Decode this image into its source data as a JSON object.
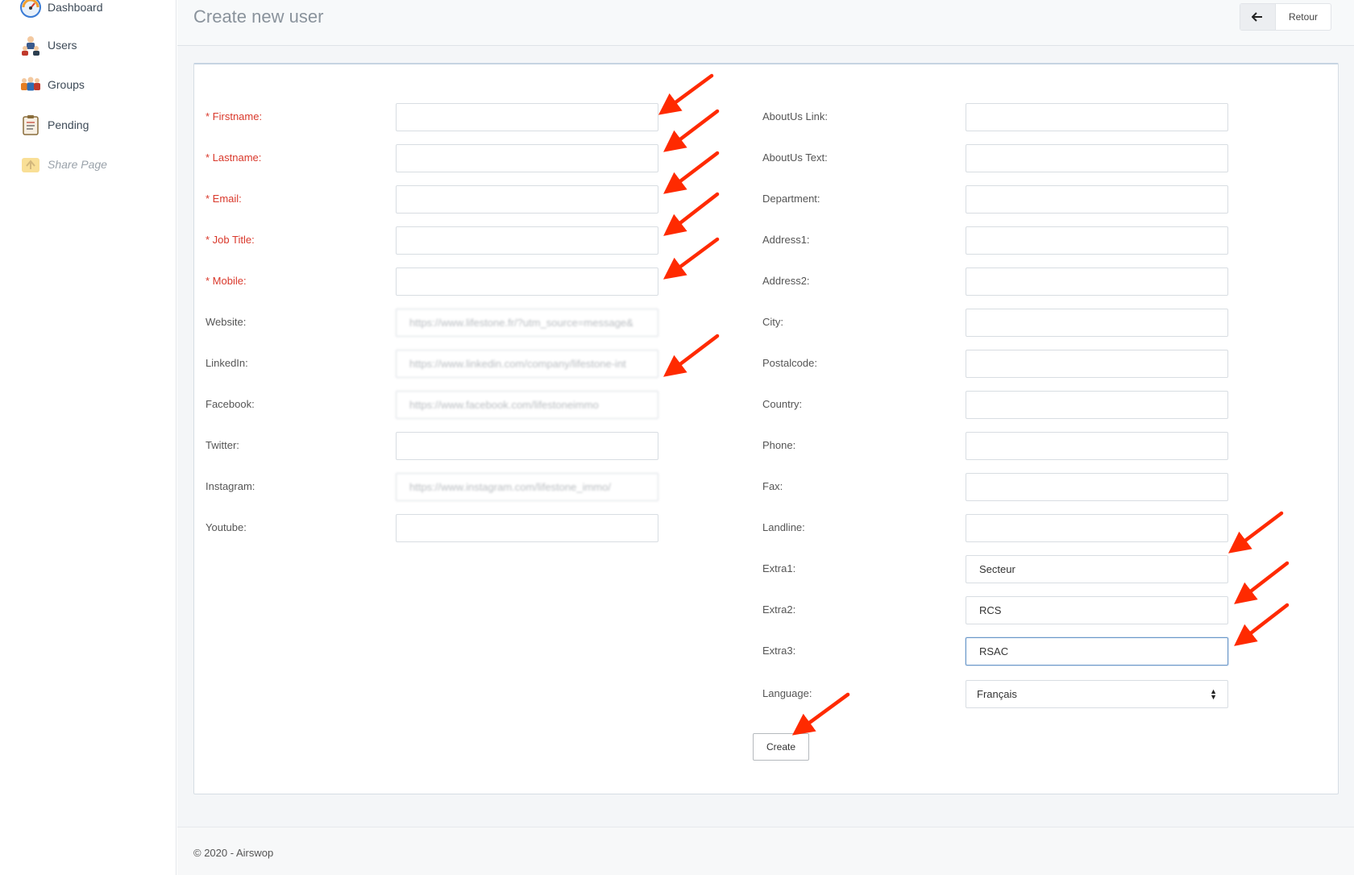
{
  "sidebar": {
    "items": [
      {
        "label": "Dashboard",
        "icon": "dashboard-icon"
      },
      {
        "label": "Users",
        "icon": "users-icon"
      },
      {
        "label": "Groups",
        "icon": "groups-icon"
      },
      {
        "label": "Pending",
        "icon": "clipboard-icon"
      },
      {
        "label": "Share Page",
        "icon": "share-icon",
        "disabled": true
      }
    ]
  },
  "header": {
    "title": "Create new user",
    "back_label": "Retour"
  },
  "form": {
    "left": [
      {
        "label": "* Firstname:",
        "value": "",
        "required": true
      },
      {
        "label": "* Lastname:",
        "value": "",
        "required": true
      },
      {
        "label": "* Email:",
        "value": "",
        "required": true
      },
      {
        "label": "* Job Title:",
        "value": "",
        "required": true
      },
      {
        "label": "* Mobile:",
        "value": "",
        "required": true
      },
      {
        "label": "Website:",
        "value": "https://www.lifestone.fr/?utm_source=message&",
        "blurred": true
      },
      {
        "label": "LinkedIn:",
        "value": "https://www.linkedin.com/company/lifestone-int",
        "blurred": true
      },
      {
        "label": "Facebook:",
        "value": "https://www.facebook.com/lifestoneimmo",
        "blurred": true
      },
      {
        "label": "Twitter:",
        "value": ""
      },
      {
        "label": "Instagram:",
        "value": "https://www.instagram.com/lifestone_immo/",
        "blurred": true
      },
      {
        "label": "Youtube:",
        "value": ""
      }
    ],
    "right": [
      {
        "label": "AboutUs Link:",
        "value": ""
      },
      {
        "label": "AboutUs Text:",
        "value": ""
      },
      {
        "label": "Department:",
        "value": ""
      },
      {
        "label": "Address1:",
        "value": ""
      },
      {
        "label": "Address2:",
        "value": ""
      },
      {
        "label": "City:",
        "value": ""
      },
      {
        "label": "Postalcode:",
        "value": ""
      },
      {
        "label": "Country:",
        "value": ""
      },
      {
        "label": "Phone:",
        "value": ""
      },
      {
        "label": "Fax:",
        "value": ""
      },
      {
        "label": "Landline:",
        "value": ""
      },
      {
        "label": "Extra1:",
        "value": "Secteur"
      },
      {
        "label": "Extra2:",
        "value": "RCS"
      },
      {
        "label": "Extra3:",
        "value": "RSAC",
        "focused": true
      }
    ],
    "language": {
      "label": "Language:",
      "selected": "Français"
    },
    "submit_label": "Create"
  },
  "footer": {
    "text": "© 2020 - Airswop"
  },
  "colors": {
    "required": "#d9382b",
    "annotation_arrow": "#ff2a00",
    "focus_border": "#6b98c9"
  }
}
